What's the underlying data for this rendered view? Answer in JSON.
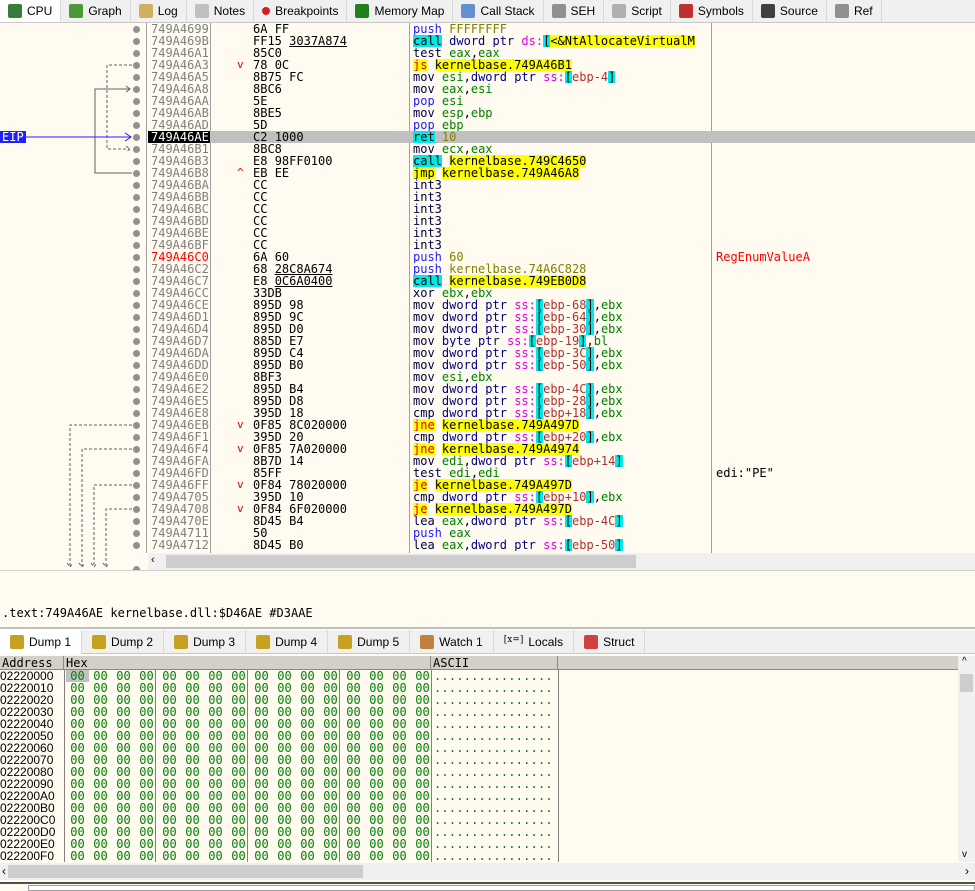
{
  "top_tabs": [
    {
      "label": "CPU",
      "icon": "cpu-icon",
      "color": "#3a7a3a",
      "active": true
    },
    {
      "label": "Graph",
      "icon": "graph-tree-icon",
      "color": "#4a9a3a"
    },
    {
      "label": "Log",
      "icon": "log-icon",
      "color": "#d0b060"
    },
    {
      "label": "Notes",
      "icon": "notes-icon",
      "color": "#c0c0c0"
    },
    {
      "label": "Breakpoints",
      "icon": "breakpoint-dot-icon",
      "color": "#d02020"
    },
    {
      "label": "Memory Map",
      "icon": "memory-map-icon",
      "color": "#208020"
    },
    {
      "label": "Call Stack",
      "icon": "call-stack-icon",
      "color": "#6090d0"
    },
    {
      "label": "SEH",
      "icon": "seh-icon",
      "color": "#909090"
    },
    {
      "label": "Script",
      "icon": "script-icon",
      "color": "#b0b0b0"
    },
    {
      "label": "Symbols",
      "icon": "symbols-icon",
      "color": "#c03030"
    },
    {
      "label": "Source",
      "icon": "source-code-icon",
      "color": "#404040"
    },
    {
      "label": "Ref",
      "icon": "references-search-icon",
      "color": "#909090"
    }
  ],
  "eip_label": "EIP",
  "disassembly": [
    {
      "addr": "749A4699",
      "op": "6A",
      "arg": "FF",
      "instr": "push FFFFFFFF"
    },
    {
      "addr": "749A469B",
      "op": "FF15",
      "arg": "3037A874",
      "reloc": true,
      "instr": "call dword ptr ds:[<&NtAllocateVirtualM"
    },
    {
      "addr": "749A46A1",
      "op": "85C0",
      "arg": "",
      "instr": "test eax,eax"
    },
    {
      "addr": "749A46A3",
      "op": "78",
      "arg": "0C",
      "jump": "v",
      "instr": "js kernelbase.749A46B1"
    },
    {
      "addr": "749A46A5",
      "op": "8B75",
      "arg": "FC",
      "instr": "mov esi,dword ptr ss:[ebp-4]"
    },
    {
      "addr": "749A46A8",
      "op": "8BC6",
      "arg": "",
      "instr": "mov eax,esi"
    },
    {
      "addr": "749A46AA",
      "op": "5E",
      "arg": "",
      "instr": "pop esi"
    },
    {
      "addr": "749A46AB",
      "op": "8BE5",
      "arg": "",
      "instr": "mov esp,ebp"
    },
    {
      "addr": "749A46AD",
      "op": "5D",
      "arg": "",
      "instr": "pop ebp"
    },
    {
      "addr": "749A46AE",
      "op": "C2",
      "arg": "1000",
      "instr": "ret 10",
      "selected": true
    },
    {
      "addr": "749A46B1",
      "op": "8BC8",
      "arg": "",
      "instr": "mov ecx,eax"
    },
    {
      "addr": "749A46B3",
      "op": "E8",
      "arg": "98FF0100",
      "instr": "call kernelbase.749C4650"
    },
    {
      "addr": "749A46B8",
      "op": "EB",
      "arg": "EE",
      "jump": "^",
      "instr": "jmp kernelbase.749A46A8"
    },
    {
      "addr": "749A46BA",
      "op": "CC",
      "arg": "",
      "instr": "int3"
    },
    {
      "addr": "749A46BB",
      "op": "CC",
      "arg": "",
      "instr": "int3"
    },
    {
      "addr": "749A46BC",
      "op": "CC",
      "arg": "",
      "instr": "int3"
    },
    {
      "addr": "749A46BD",
      "op": "CC",
      "arg": "",
      "instr": "int3"
    },
    {
      "addr": "749A46BE",
      "op": "CC",
      "arg": "",
      "instr": "int3"
    },
    {
      "addr": "749A46BF",
      "op": "CC",
      "arg": "",
      "instr": "int3"
    },
    {
      "addr": "749A46C0",
      "op": "6A",
      "arg": "60",
      "instr": "push 60",
      "label": true,
      "comment": "RegEnumValueA"
    },
    {
      "addr": "749A46C2",
      "op": "68",
      "arg": "28C8A674",
      "reloc": true,
      "instr": "push kernelbase.74A6C828"
    },
    {
      "addr": "749A46C7",
      "op": "E8",
      "arg": "0C6A0400",
      "reloc": true,
      "instr": "call kernelbase.749EB0D8"
    },
    {
      "addr": "749A46CC",
      "op": "33DB",
      "arg": "",
      "instr": "xor ebx,ebx"
    },
    {
      "addr": "749A46CE",
      "op": "895D",
      "arg": "98",
      "instr": "mov dword ptr ss:[ebp-68],ebx"
    },
    {
      "addr": "749A46D1",
      "op": "895D",
      "arg": "9C",
      "instr": "mov dword ptr ss:[ebp-64],ebx"
    },
    {
      "addr": "749A46D4",
      "op": "895D",
      "arg": "D0",
      "instr": "mov dword ptr ss:[ebp-30],ebx"
    },
    {
      "addr": "749A46D7",
      "op": "885D",
      "arg": "E7",
      "instr": "mov byte ptr ss:[ebp-19],bl"
    },
    {
      "addr": "749A46DA",
      "op": "895D",
      "arg": "C4",
      "instr": "mov dword ptr ss:[ebp-3C],ebx"
    },
    {
      "addr": "749A46DD",
      "op": "895D",
      "arg": "B0",
      "instr": "mov dword ptr ss:[ebp-50],ebx"
    },
    {
      "addr": "749A46E0",
      "op": "8BF3",
      "arg": "",
      "instr": "mov esi,ebx"
    },
    {
      "addr": "749A46E2",
      "op": "895D",
      "arg": "B4",
      "instr": "mov dword ptr ss:[ebp-4C],ebx"
    },
    {
      "addr": "749A46E5",
      "op": "895D",
      "arg": "D8",
      "instr": "mov dword ptr ss:[ebp-28],ebx"
    },
    {
      "addr": "749A46E8",
      "op": "395D",
      "arg": "18",
      "instr": "cmp dword ptr ss:[ebp+18],ebx"
    },
    {
      "addr": "749A46EB",
      "op": "0F85",
      "arg": "8C020000",
      "jump": "v",
      "instr": "jne kernelbase.749A497D"
    },
    {
      "addr": "749A46F1",
      "op": "395D",
      "arg": "20",
      "instr": "cmp dword ptr ss:[ebp+20],ebx"
    },
    {
      "addr": "749A46F4",
      "op": "0F85",
      "arg": "7A020000",
      "jump": "v",
      "instr": "jne kernelbase.749A4974"
    },
    {
      "addr": "749A46FA",
      "op": "8B7D",
      "arg": "14",
      "instr": "mov edi,dword ptr ss:[ebp+14]"
    },
    {
      "addr": "749A46FD",
      "op": "85FF",
      "arg": "",
      "instr": "test edi,edi",
      "comment": "edi:\"PE\"",
      "comment_dark": true
    },
    {
      "addr": "749A46FF",
      "op": "0F84",
      "arg": "78020000",
      "jump": "v",
      "instr": "je kernelbase.749A497D"
    },
    {
      "addr": "749A4705",
      "op": "395D",
      "arg": "10",
      "instr": "cmp dword ptr ss:[ebp+10],ebx"
    },
    {
      "addr": "749A4708",
      "op": "0F84",
      "arg": "6F020000",
      "jump": "v",
      "instr": "je kernelbase.749A497D"
    },
    {
      "addr": "749A470E",
      "op": "8D45",
      "arg": "B4",
      "instr": "lea eax,dword ptr ss:[ebp-4C]"
    },
    {
      "addr": "749A4711",
      "op": "50",
      "arg": "",
      "instr": "push eax"
    },
    {
      "addr": "749A4712",
      "op": "8D45",
      "arg": "B0",
      "instr": "lea eax,dword ptr ss:[ebp-50]"
    }
  ],
  "info_line": ".text:749A46AE kernelbase.dll:$D46AE #D3AAE",
  "dump_tabs": [
    {
      "label": "Dump 1",
      "icon": "dump-icon",
      "active": true
    },
    {
      "label": "Dump 2",
      "icon": "dump-icon"
    },
    {
      "label": "Dump 3",
      "icon": "dump-icon"
    },
    {
      "label": "Dump 4",
      "icon": "dump-icon"
    },
    {
      "label": "Dump 5",
      "icon": "dump-icon"
    },
    {
      "label": "Watch 1",
      "icon": "watch-dog-icon"
    },
    {
      "label": "Locals",
      "icon": "locals-variable-icon"
    },
    {
      "label": "Struct",
      "icon": "struct-candy-icon"
    }
  ],
  "dump_headers": {
    "address": "Address",
    "hex": "Hex",
    "ascii": "ASCII"
  },
  "dump_rows": [
    {
      "addr": "02220000",
      "hex": "00 00 00 00 00 00 00 00 00 00 00 00 00 00 00 00",
      "ascii": "................"
    },
    {
      "addr": "02220010",
      "hex": "00 00 00 00 00 00 00 00 00 00 00 00 00 00 00 00",
      "ascii": "................"
    },
    {
      "addr": "02220020",
      "hex": "00 00 00 00 00 00 00 00 00 00 00 00 00 00 00 00",
      "ascii": "................"
    },
    {
      "addr": "02220030",
      "hex": "00 00 00 00 00 00 00 00 00 00 00 00 00 00 00 00",
      "ascii": "................"
    },
    {
      "addr": "02220040",
      "hex": "00 00 00 00 00 00 00 00 00 00 00 00 00 00 00 00",
      "ascii": "................"
    },
    {
      "addr": "02220050",
      "hex": "00 00 00 00 00 00 00 00 00 00 00 00 00 00 00 00",
      "ascii": "................"
    },
    {
      "addr": "02220060",
      "hex": "00 00 00 00 00 00 00 00 00 00 00 00 00 00 00 00",
      "ascii": "................"
    },
    {
      "addr": "02220070",
      "hex": "00 00 00 00 00 00 00 00 00 00 00 00 00 00 00 00",
      "ascii": "................"
    },
    {
      "addr": "02220080",
      "hex": "00 00 00 00 00 00 00 00 00 00 00 00 00 00 00 00",
      "ascii": "................"
    },
    {
      "addr": "02220090",
      "hex": "00 00 00 00 00 00 00 00 00 00 00 00 00 00 00 00",
      "ascii": "................"
    },
    {
      "addr": "022200A0",
      "hex": "00 00 00 00 00 00 00 00 00 00 00 00 00 00 00 00",
      "ascii": "................"
    },
    {
      "addr": "022200B0",
      "hex": "00 00 00 00 00 00 00 00 00 00 00 00 00 00 00 00",
      "ascii": "................"
    },
    {
      "addr": "022200C0",
      "hex": "00 00 00 00 00 00 00 00 00 00 00 00 00 00 00 00",
      "ascii": "................"
    },
    {
      "addr": "022200D0",
      "hex": "00 00 00 00 00 00 00 00 00 00 00 00 00 00 00 00",
      "ascii": "................"
    },
    {
      "addr": "022200E0",
      "hex": "00 00 00 00 00 00 00 00 00 00 00 00 00 00 00 00",
      "ascii": "................"
    },
    {
      "addr": "022200F0",
      "hex": "00 00 00 00 00 00 00 00 00 00 00 00 00 00 00 00",
      "ascii": "................"
    }
  ],
  "colors": {
    "background": "#fffbf0",
    "call_highlight": "#00e8e8",
    "jump_highlight": "#ffff00",
    "eip": "#2020ff",
    "bytes": "#008000"
  }
}
